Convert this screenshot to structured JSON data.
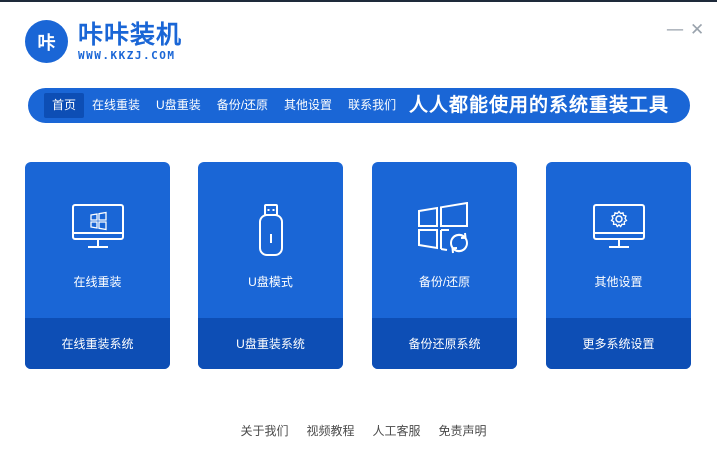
{
  "app": {
    "logo_mark": "咔",
    "title": "咔咔装机",
    "subtitle": "WWW.KKZJ.COM"
  },
  "window": {
    "minimize_label": "—",
    "close_label": "✕"
  },
  "nav": {
    "items": [
      {
        "label": "首页",
        "active": true
      },
      {
        "label": "在线重装",
        "active": false
      },
      {
        "label": "U盘重装",
        "active": false
      },
      {
        "label": "备份/还原",
        "active": false
      },
      {
        "label": "其他设置",
        "active": false
      },
      {
        "label": "联系我们",
        "active": false
      }
    ],
    "slogan": "人人都能使用的系统重装工具"
  },
  "cards": [
    {
      "title": "在线重装",
      "action": "在线重装系统",
      "icon": "monitor-windows-icon"
    },
    {
      "title": "U盘模式",
      "action": "U盘重装系统",
      "icon": "usb-drive-icon"
    },
    {
      "title": "备份/还原",
      "action": "备份还原系统",
      "icon": "windows-restore-icon"
    },
    {
      "title": "其他设置",
      "action": "更多系统设置",
      "icon": "monitor-gear-icon"
    }
  ],
  "footer": {
    "links": [
      "关于我们",
      "视频教程",
      "人工客服",
      "免责声明"
    ]
  },
  "colors": {
    "primary": "#1a66d6",
    "primary_dark": "#0d4eb5",
    "footer_text": "#4a4a4a"
  }
}
